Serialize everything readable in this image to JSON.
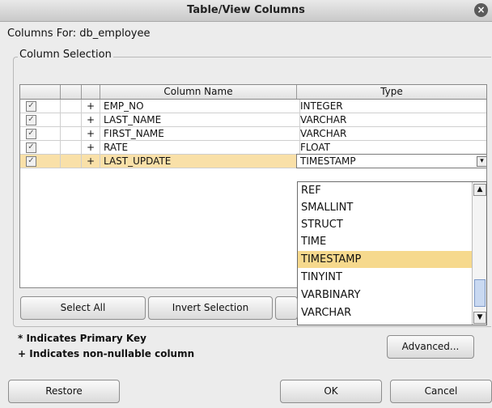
{
  "window": {
    "title": "Table/View Columns"
  },
  "columns_for": "Columns For: db_employee",
  "group_label": "Column Selection",
  "table": {
    "headers": [
      "",
      "",
      "",
      "Column Name",
      "Type"
    ],
    "rows": [
      {
        "checked": true,
        "plus": "+",
        "name": "EMP_NO",
        "type": "INTEGER"
      },
      {
        "checked": true,
        "plus": "+",
        "name": "LAST_NAME",
        "type": "VARCHAR"
      },
      {
        "checked": true,
        "plus": "+",
        "name": "FIRST_NAME",
        "type": "VARCHAR"
      },
      {
        "checked": true,
        "plus": "+",
        "name": "RATE",
        "type": "FLOAT"
      },
      {
        "checked": true,
        "plus": "+",
        "name": "LAST_UPDATE",
        "type": "TIMESTAMP"
      }
    ]
  },
  "type_dropdown": {
    "options": [
      "REF",
      "SMALLINT",
      "STRUCT",
      "TIME",
      "TIMESTAMP",
      "TINYINT",
      "VARBINARY",
      "VARCHAR"
    ],
    "selected": "TIMESTAMP"
  },
  "buttons": {
    "select_all": "Select All",
    "invert_selection": "Invert Selection",
    "advanced": "Advanced...",
    "restore": "Restore",
    "ok": "OK",
    "cancel": "Cancel"
  },
  "notes": {
    "primary_key": "* Indicates Primary Key",
    "non_nullable": "+ Indicates non-nullable column"
  },
  "colors": {
    "selection": "#f9e0a8",
    "dropdown_selection": "#f6d98d"
  }
}
